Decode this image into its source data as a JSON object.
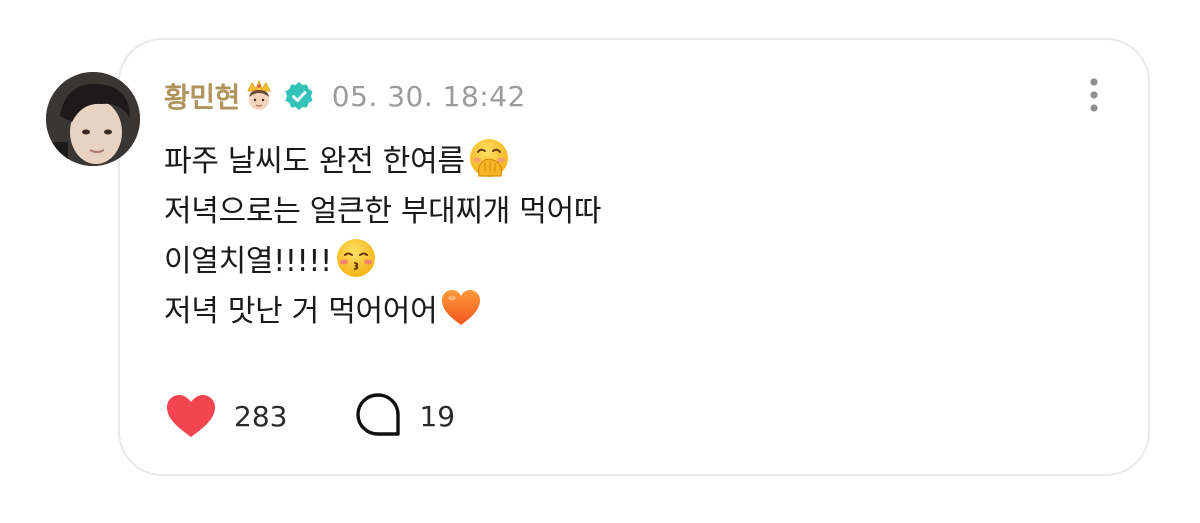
{
  "post": {
    "author": "황민현",
    "author_badge_icon": "prince-crown-emoji",
    "verified_icon": "verified-badge-icon",
    "timestamp": "05. 30. 18:42",
    "more_icon": "more-vertical-icon",
    "lines": [
      {
        "text": "파주 날씨도 완전 한여름",
        "emoji": "face-with-hand-over-mouth"
      },
      {
        "text": "저녁으로는 얼큰한 부대찌개 먹어따",
        "emoji": ""
      },
      {
        "text": "이열치열!!!!!",
        "emoji": "kissing-face-with-closed-eyes"
      },
      {
        "text": "저녁 맛난 거 먹어어어",
        "emoji": "orange-heart"
      }
    ],
    "likes": "283",
    "comments": "19"
  },
  "colors": {
    "author": "#b0945c",
    "timestamp": "#9b9b9b",
    "verified": "#33c3b8",
    "heart": "#f2454f",
    "border": "#e9e9e9"
  }
}
